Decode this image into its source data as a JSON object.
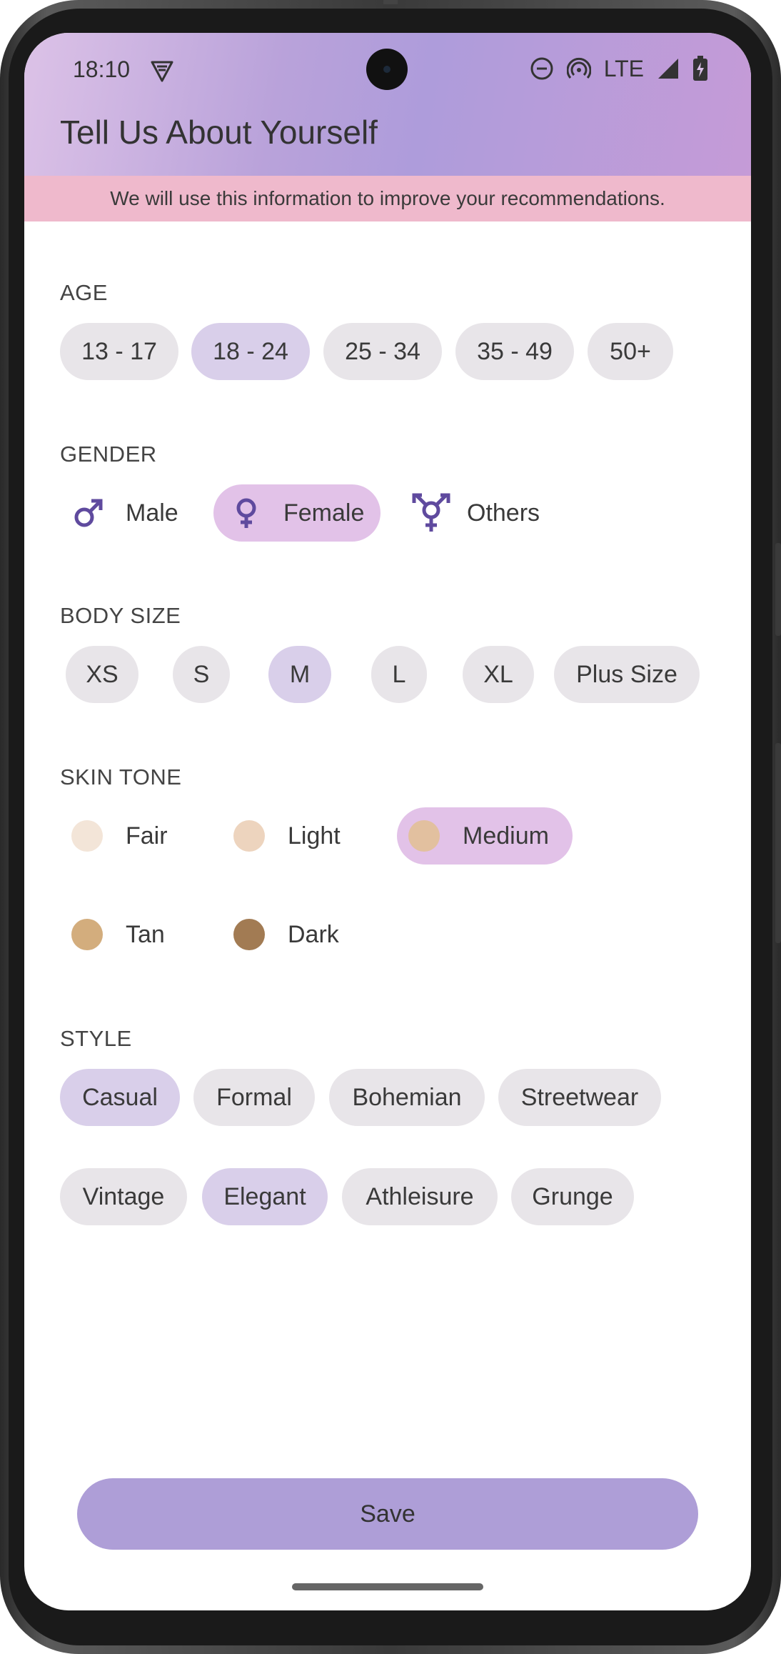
{
  "status_bar": {
    "time": "18:10",
    "network": "LTE"
  },
  "header": {
    "title": "Tell Us About Yourself"
  },
  "banner": {
    "text": "We will use this information to improve your recommendations."
  },
  "age": {
    "label": "AGE",
    "options": [
      "13 - 17",
      "18 - 24",
      "25 - 34",
      "35 - 49",
      "50+"
    ],
    "selected": "18 - 24"
  },
  "gender": {
    "label": "GENDER",
    "options": [
      {
        "label": "Male",
        "icon": "male-symbol-icon"
      },
      {
        "label": "Female",
        "icon": "female-symbol-icon"
      },
      {
        "label": "Others",
        "icon": "transgender-symbol-icon"
      }
    ],
    "selected": "Female"
  },
  "body_size": {
    "label": "BODY SIZE",
    "options": [
      "XS",
      "S",
      "M",
      "L",
      "XL",
      "Plus Size"
    ],
    "selected": "M"
  },
  "skin_tone": {
    "label": "SKIN TONE",
    "options": [
      {
        "label": "Fair",
        "color": "#f3e5d8"
      },
      {
        "label": "Light",
        "color": "#edd4be"
      },
      {
        "label": "Medium",
        "color": "#e2c09f"
      },
      {
        "label": "Tan",
        "color": "#d3ad7d"
      },
      {
        "label": "Dark",
        "color": "#a27b53"
      }
    ],
    "selected": "Medium"
  },
  "style": {
    "label": "STYLE",
    "options": [
      "Casual",
      "Formal",
      "Bohemian",
      "Streetwear",
      "Vintage",
      "Elegant",
      "Athleisure",
      "Grunge"
    ],
    "selected": [
      "Casual",
      "Elegant"
    ]
  },
  "actions": {
    "save_label": "Save"
  },
  "colors": {
    "accent": "#ae9ed7",
    "icon_purple": "#5f4a9e",
    "chip_bg": "#e8e5e9",
    "chip_selected": "#d9cfea",
    "option_selected": "#e2c2e8",
    "banner_bg": "#efb9cc"
  }
}
